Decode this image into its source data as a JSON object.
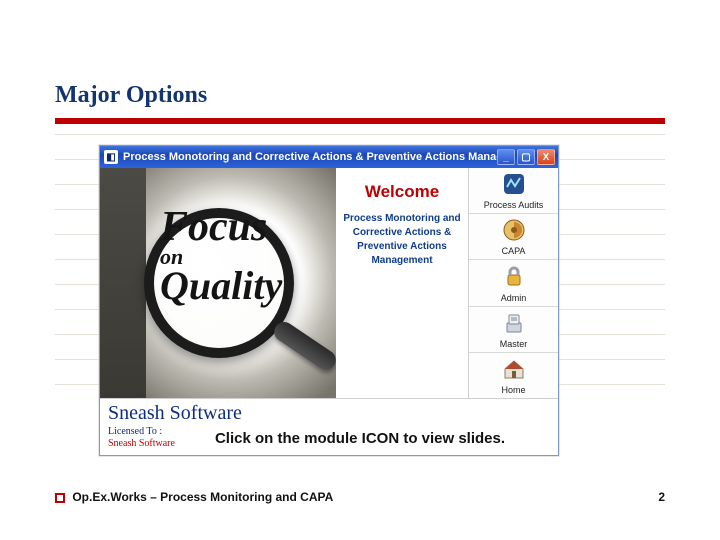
{
  "slide": {
    "title": "Major Options",
    "caption": "Click on the module ICON to view slides.",
    "footer_text": "Op.Ex.Works – Process Monitoring and CAPA",
    "page_number": "2"
  },
  "window": {
    "title": "Process Monotoring and Corrective Actions & Preventive Actions Management",
    "buttons": {
      "minimize": "_",
      "maximize": "▢",
      "close": "X"
    },
    "welcome": "Welcome",
    "product_line1": "Process Monotoring and",
    "product_line2": "Corrective Actions & Preventive Actions",
    "product_line3": "Management",
    "hero": {
      "line1": "Focus",
      "line2": "on",
      "line3": "Quality"
    },
    "brand": "Sneash Software",
    "licensed_label": "Licensed To :",
    "licensed_value": "Sneash Software"
  },
  "modules": [
    {
      "key": "process-audits",
      "label": "Process Audits"
    },
    {
      "key": "capa",
      "label": "CAPA"
    },
    {
      "key": "admin",
      "label": "Admin"
    },
    {
      "key": "master",
      "label": "Master"
    },
    {
      "key": "home",
      "label": "Home"
    }
  ]
}
